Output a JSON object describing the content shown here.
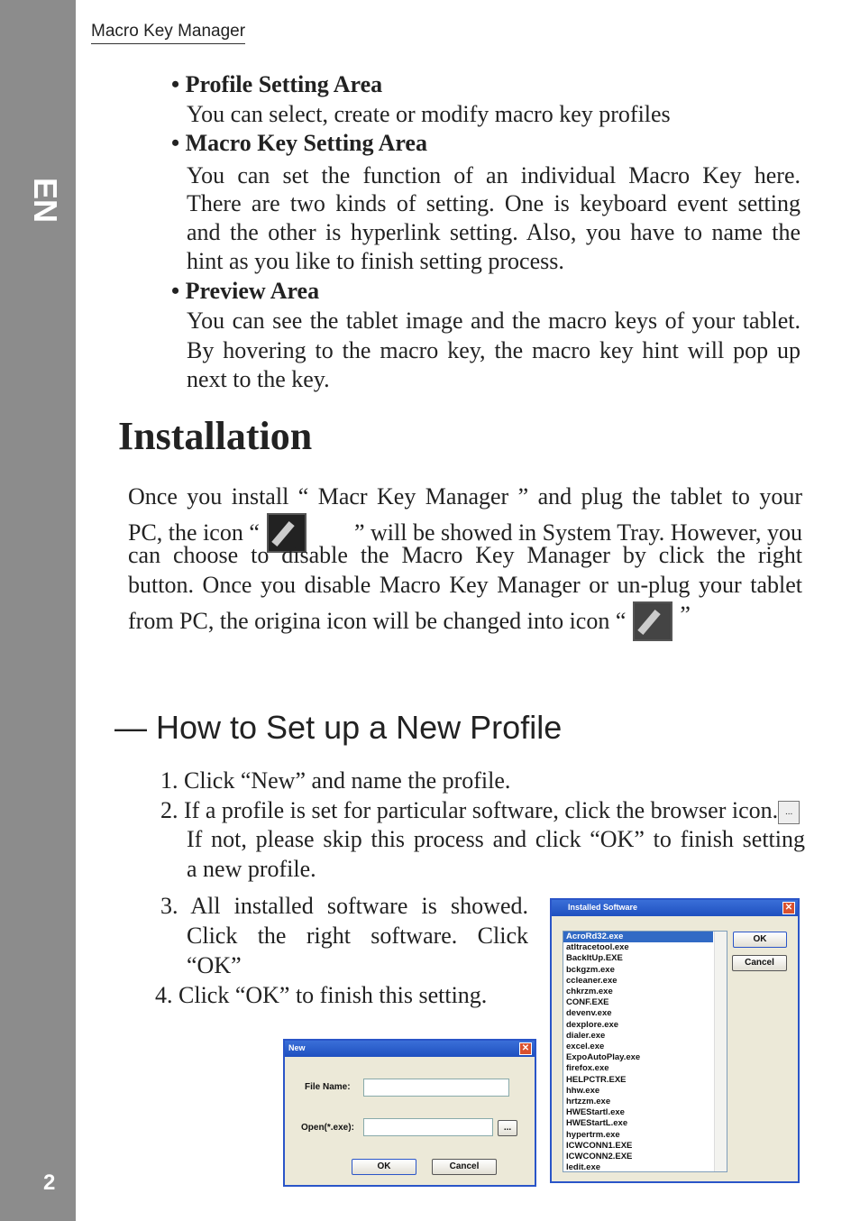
{
  "side": {
    "lang": "EN",
    "page": "2"
  },
  "header": "Macro Key Manager",
  "areas": [
    {
      "title": "• Profile Setting Area",
      "lines": [
        "You can select, create or modify macro key profiles"
      ]
    },
    {
      "title": "• Macro Key Setting Area",
      "lines": [
        "You can set the function of an individual Macro Key here.",
        "There are two kinds of setting. One is keyboard event setting",
        "and the other is hyperlink setting. Also, you have to name the",
        "hint as you like to finish setting process."
      ]
    },
    {
      "title": "• Preview Area",
      "lines": [
        "You can see the tablet image and the macro keys of your tablet.",
        "By hovering to the macro key, the macro key hint will pop up",
        "next to the key."
      ]
    }
  ],
  "installation": {
    "title": "Installation",
    "l1": "Once you install  “ Macr Key Manager ” and plug the tablet to your",
    "l2a": "PC, the icon “",
    "l2b": "” will be showed in System Tray. However, you",
    "l3": "can choose to disable the Macro Key Manager by click the right",
    "l4": "button. Once you disable Macro Key Manager or un-plug your tablet",
    "l5a": "from PC, the origina icon will be changed into icon “",
    "l5b": "”"
  },
  "howto": {
    "title": "— How to Set up a New Profile",
    "s1": "1. Click “New” and name the profile.",
    "s2": "2. If a profile is set for particular software, click the browser icon.",
    "s2b": [
      "If not, please skip this process and click “OK” to finish setting",
      "a new profile."
    ],
    "s3": [
      "3.  All installed software is showed.",
      "Click the right software. Click",
      "“OK”"
    ],
    "s4": "4.  Click “OK” to finish this setting.",
    "browse": "..."
  },
  "new_dialog": {
    "title": "New",
    "file_name_label": "File Name:",
    "open_label": "Open(*.exe):",
    "browse": "...",
    "ok": "OK",
    "cancel": "Cancel",
    "close": "✕"
  },
  "installed_dialog": {
    "title": "Installed Software",
    "ok": "OK",
    "cancel": "Cancel",
    "close": "✕",
    "selected": "AcroRd32.exe",
    "items": [
      "AcroRd32.exe",
      "atltracetool.exe",
      "BackItUp.EXE",
      "bckgzm.exe",
      "ccleaner.exe",
      "chkrzm.exe",
      "CONF.EXE",
      "devenv.exe",
      "dexplore.exe",
      "dialer.exe",
      "excel.exe",
      "ExpoAutoPlay.exe",
      "firefox.exe",
      "HELPCTR.EXE",
      "hhw.exe",
      "hrtzzm.exe",
      "HWEStartl.exe",
      "HWEStartL.exe",
      "hypertrm.exe",
      "ICWCONN1.EXE",
      "ICWCONN2.EXE",
      "ledit.exe"
    ]
  }
}
